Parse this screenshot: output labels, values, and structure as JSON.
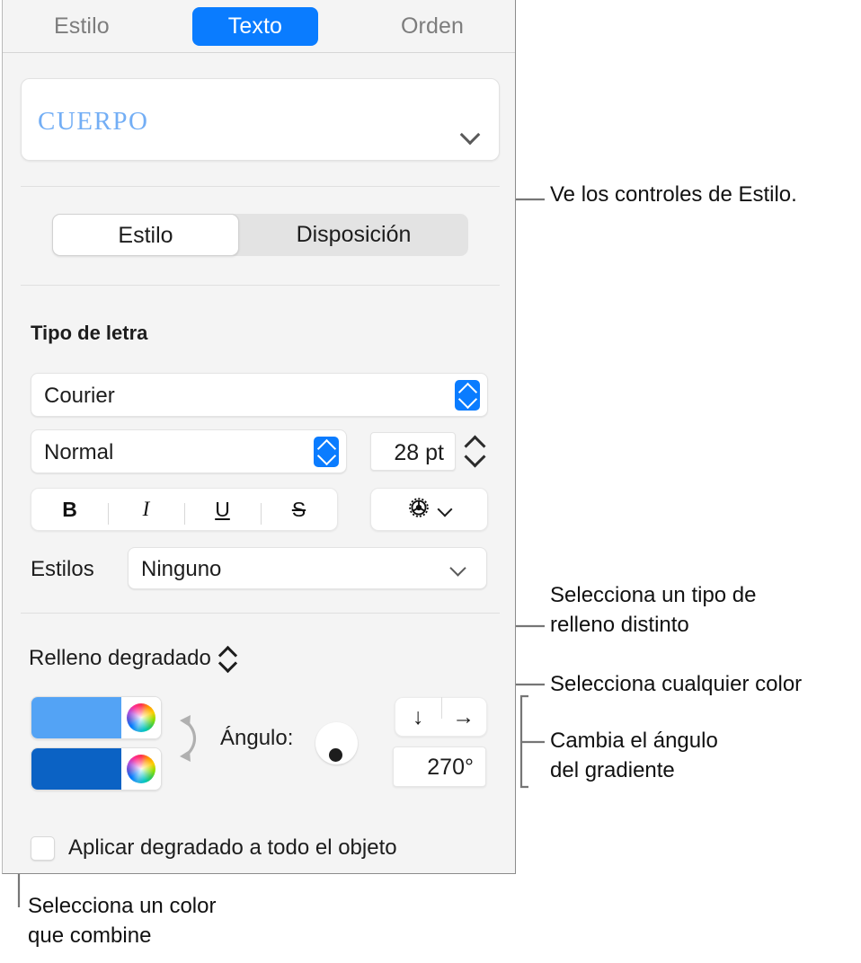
{
  "accent_color": "#0a7cff",
  "panel": {
    "tabs": [
      {
        "label": "Estilo",
        "active": false
      },
      {
        "label": "Texto",
        "active": true
      },
      {
        "label": "Orden",
        "active": false
      }
    ],
    "style_popup": {
      "value": "CUERPO",
      "chevron_icon": "chevron-down-icon"
    },
    "segmented": [
      {
        "label": "Estilo",
        "active": true
      },
      {
        "label": "Disposición",
        "active": false
      }
    ],
    "font_section": {
      "title": "Tipo de letra",
      "family": "Courier",
      "weight": "Normal",
      "size": "28 pt",
      "format_buttons": [
        {
          "label": "B",
          "name": "bold"
        },
        {
          "label": "I",
          "name": "italic"
        },
        {
          "label": "U",
          "name": "underline"
        },
        {
          "label": "S",
          "name": "strikethrough"
        }
      ],
      "gear_icon": "gear-icon",
      "gear_chevron_icon": "chevron-down-icon",
      "styles_label": "Estilos",
      "styles_value": "Ninguno"
    },
    "fill_section": {
      "fill_type": "Relleno degradado",
      "fill_type_stepper_icon": "up-down-chevron-icon",
      "color_start": "#53a3f5",
      "color_end": "#0b62c4",
      "color_wheel_icon": "color-wheel-icon",
      "swap_icon": "swap-arrows-icon",
      "angle_label": "Ángulo:",
      "angle_value": "270°",
      "direction_buttons": [
        {
          "glyph": "↓",
          "name": "gradient-direction-down"
        },
        {
          "glyph": "→",
          "name": "gradient-direction-right"
        }
      ],
      "apply_checkbox_label": "Aplicar degradado a todo el objeto",
      "apply_checkbox_checked": false
    }
  },
  "callouts": [
    {
      "id": "style-controls",
      "text": "Ve los controles de Estilo."
    },
    {
      "id": "fill-type",
      "text": "Selecciona un tipo de\nrelleno distinto"
    },
    {
      "id": "any-color",
      "text": "Selecciona cualquier color"
    },
    {
      "id": "gradient-angle",
      "text": "Cambia el ángulo\ndel gradiente"
    },
    {
      "id": "matching-color",
      "text": "Selecciona un color\nque combine"
    }
  ]
}
